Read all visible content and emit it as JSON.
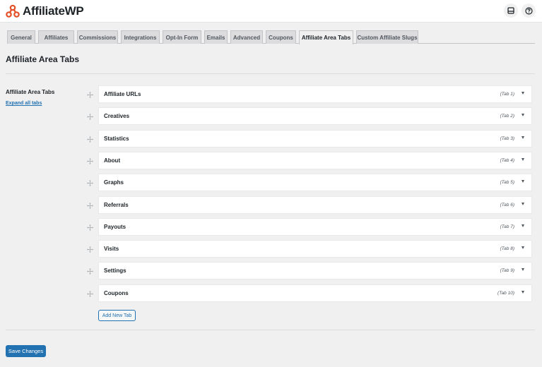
{
  "header": {
    "brand": "AffiliateWP"
  },
  "tabs": [
    {
      "label": "General"
    },
    {
      "label": "Affiliates"
    },
    {
      "label": "Commissions"
    },
    {
      "label": "Integrations"
    },
    {
      "label": "Opt-In Form"
    },
    {
      "label": "Emails"
    },
    {
      "label": "Advanced"
    },
    {
      "label": "Coupons"
    },
    {
      "label": "Affiliate Area Tabs",
      "active": true
    },
    {
      "label": "Custom Affiliate Slugs"
    }
  ],
  "page": {
    "title": "Affiliate Area Tabs",
    "section_label": "Affiliate Area Tabs",
    "expand_link": "Expand all tabs"
  },
  "area_tabs": [
    {
      "title": "Affiliate URLs",
      "num": "(Tab 1)"
    },
    {
      "title": "Creatives",
      "num": "(Tab 2)"
    },
    {
      "title": "Statistics",
      "num": "(Tab 3)"
    },
    {
      "title": "About",
      "num": "(Tab 4)"
    },
    {
      "title": "Graphs",
      "num": "(Tab 5)"
    },
    {
      "title": "Referrals",
      "num": "(Tab 6)"
    },
    {
      "title": "Payouts",
      "num": "(Tab 7)"
    },
    {
      "title": "Visits",
      "num": "(Tab 8)"
    },
    {
      "title": "Settings",
      "num": "(Tab 9)"
    },
    {
      "title": "Coupons",
      "num": "(Tab 10)"
    }
  ],
  "actions": {
    "add_new_tab": "Add New Tab",
    "save_changes": "Save Changes"
  },
  "colors": {
    "accent": "#2271b1",
    "brand": "#e34f26"
  },
  "icons": {
    "logo": "affiliatewp-logo-icon",
    "inbox": "inbox-icon",
    "help": "help-icon",
    "drag": "drag-handle-icon",
    "toggle": "caret-down-icon"
  }
}
